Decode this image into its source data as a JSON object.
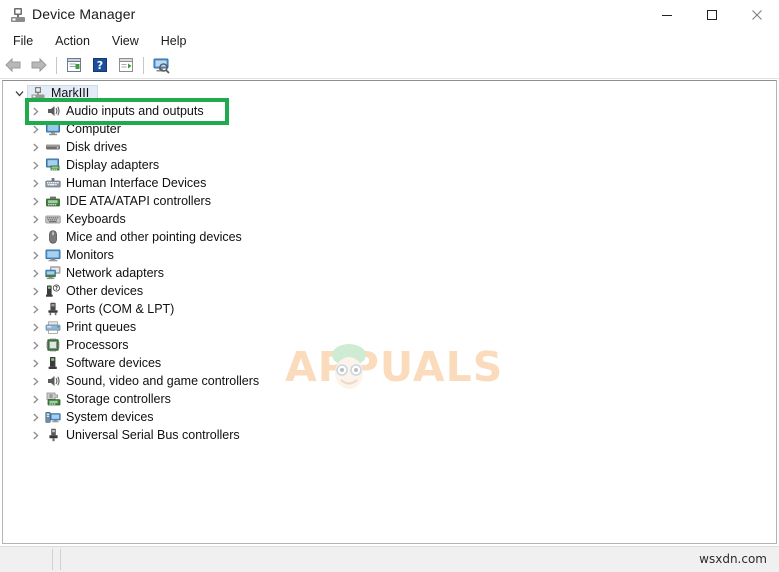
{
  "window": {
    "title": "Device Manager",
    "title_icon": "device-manager-icon",
    "caption": {
      "minimize": "minimize-icon",
      "maximize": "maximize-icon",
      "close": "close-icon"
    }
  },
  "menubar": {
    "items": [
      {
        "label": "File"
      },
      {
        "label": "Action"
      },
      {
        "label": "View"
      },
      {
        "label": "Help"
      }
    ]
  },
  "toolbar": {
    "buttons": [
      {
        "name": "back-arrow-icon",
        "title": "Back"
      },
      {
        "name": "forward-arrow-icon",
        "title": "Forward"
      },
      {
        "name": "properties-icon",
        "title": "Properties"
      },
      {
        "name": "help-icon",
        "title": "Help"
      },
      {
        "name": "show-hidden-devices-icon",
        "title": "Show hidden devices"
      },
      {
        "name": "scan-hardware-changes-icon",
        "title": "Scan for hardware changes"
      }
    ]
  },
  "tree": {
    "root": {
      "label": "MarkIII",
      "icon": "computer-icon",
      "expanded": true,
      "selected": true
    },
    "items": [
      {
        "label": "Audio inputs and outputs",
        "icon": "speaker-icon",
        "highlighted": true
      },
      {
        "label": "Computer",
        "icon": "monitor-icon"
      },
      {
        "label": "Disk drives",
        "icon": "disk-drive-icon"
      },
      {
        "label": "Display adapters",
        "icon": "display-adapter-icon"
      },
      {
        "label": "Human Interface Devices",
        "icon": "hid-icon"
      },
      {
        "label": "IDE ATA/ATAPI controllers",
        "icon": "ide-controller-icon"
      },
      {
        "label": "Keyboards",
        "icon": "keyboard-icon"
      },
      {
        "label": "Mice and other pointing devices",
        "icon": "mouse-icon"
      },
      {
        "label": "Monitors",
        "icon": "monitor-screen-icon"
      },
      {
        "label": "Network adapters",
        "icon": "network-adapter-icon"
      },
      {
        "label": "Other devices",
        "icon": "unknown-device-icon"
      },
      {
        "label": "Ports (COM & LPT)",
        "icon": "port-icon"
      },
      {
        "label": "Print queues",
        "icon": "printer-icon"
      },
      {
        "label": "Processors",
        "icon": "processor-icon"
      },
      {
        "label": "Software devices",
        "icon": "software-device-icon"
      },
      {
        "label": "Sound, video and game controllers",
        "icon": "sound-controller-icon"
      },
      {
        "label": "Storage controllers",
        "icon": "storage-controller-icon"
      },
      {
        "label": "System devices",
        "icon": "system-device-icon"
      },
      {
        "label": "Universal Serial Bus controllers",
        "icon": "usb-controller-icon"
      }
    ]
  },
  "annotation": {
    "type": "highlight-rectangle",
    "target": "Audio inputs and outputs",
    "color": "#1faa4b"
  },
  "watermark": {
    "text": "APPUALS",
    "color": "#f08a26"
  },
  "statusbar": {
    "text": "wsxdn.com"
  }
}
